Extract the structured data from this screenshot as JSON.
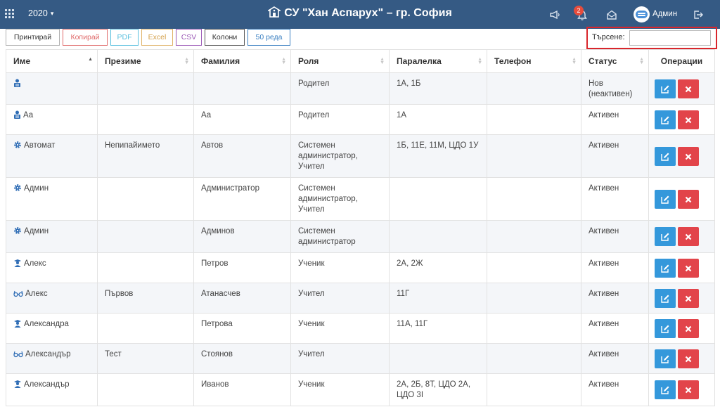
{
  "header": {
    "year": "2020",
    "school_title": "СУ \"Хан Аспарух\" – гр. София",
    "notification_count": "2",
    "user_name": "Админ"
  },
  "toolbar": {
    "print": "Принтирай",
    "copy": "Копирай",
    "pdf": "PDF",
    "excel": "Excel",
    "csv": "CSV",
    "columns": "Колони",
    "page_size": "50 реда"
  },
  "search": {
    "label": "Търсене:",
    "value": ""
  },
  "table": {
    "columns": [
      "Име",
      "Презиме",
      "Фамилия",
      "Роля",
      "Паралелка",
      "Телефон",
      "Статус",
      "Операции"
    ],
    "rows": [
      {
        "icon": "parent-icon",
        "first": "",
        "middle": "",
        "last": "",
        "role": "Родител",
        "classes": "1А, 1Б",
        "phone": "",
        "status": "Нов (неактивен)"
      },
      {
        "icon": "parent-icon",
        "first": "Аа",
        "middle": "",
        "last": "Аа",
        "role": "Родител",
        "classes": "1А",
        "phone": "",
        "status": "Активен"
      },
      {
        "icon": "admin-gear-icon",
        "first": "Автомат",
        "middle": "Непипайимето",
        "last": "Автов",
        "role": "Системен администратор, Учител",
        "classes": "1Б, 11Е, 11М, ЦДО 1У",
        "phone": "",
        "status": "Активен"
      },
      {
        "icon": "admin-gear-icon",
        "first": "Админ",
        "middle": "",
        "last": "Администратор",
        "role": "Системен администратор, Учител",
        "classes": "",
        "phone": "",
        "status": "Активен"
      },
      {
        "icon": "admin-gear-icon",
        "first": "Админ",
        "middle": "",
        "last": "Админов",
        "role": "Системен администратор",
        "classes": "",
        "phone": "",
        "status": "Активен"
      },
      {
        "icon": "student-icon",
        "first": "Алекс",
        "middle": "",
        "last": "Петров",
        "role": "Ученик",
        "classes": "2А, 2Ж",
        "phone": "",
        "status": "Активен"
      },
      {
        "icon": "teacher-glasses-icon",
        "first": "Алекс",
        "middle": "Първов",
        "last": "Атанасчев",
        "role": "Учител",
        "classes": "11Г",
        "phone": "",
        "status": "Активен"
      },
      {
        "icon": "student-icon",
        "first": "Александра",
        "middle": "",
        "last": "Петрова",
        "role": "Ученик",
        "classes": "11А, 11Г",
        "phone": "",
        "status": "Активен"
      },
      {
        "icon": "teacher-glasses-icon",
        "first": "Александър",
        "middle": "Тест",
        "last": "Стоянов",
        "role": "Учител",
        "classes": "",
        "phone": "",
        "status": "Активен"
      },
      {
        "icon": "student-icon",
        "first": "Александър",
        "middle": "",
        "last": "Иванов",
        "role": "Ученик",
        "classes": "2А, 2Б, 8Т, ЦДО 2А, ЦДО 3І",
        "phone": "",
        "status": "Активен"
      }
    ]
  },
  "colors": {
    "header_bg": "#355a84",
    "link": "#2f6db5",
    "edit": "#3498db",
    "delete": "#e2444a",
    "search_highlight": "#d9262c"
  }
}
